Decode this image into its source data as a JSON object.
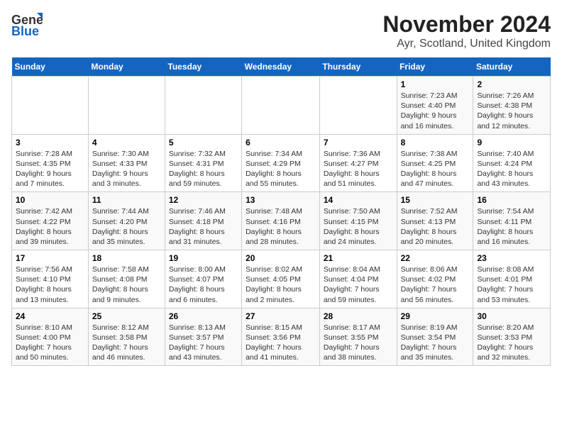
{
  "logo": {
    "line1": "General",
    "line2": "Blue"
  },
  "title": "November 2024",
  "subtitle": "Ayr, Scotland, United Kingdom",
  "headers": [
    "Sunday",
    "Monday",
    "Tuesday",
    "Wednesday",
    "Thursday",
    "Friday",
    "Saturday"
  ],
  "weeks": [
    [
      {
        "day": "",
        "info": ""
      },
      {
        "day": "",
        "info": ""
      },
      {
        "day": "",
        "info": ""
      },
      {
        "day": "",
        "info": ""
      },
      {
        "day": "",
        "info": ""
      },
      {
        "day": "1",
        "info": "Sunrise: 7:23 AM\nSunset: 4:40 PM\nDaylight: 9 hours and 16 minutes."
      },
      {
        "day": "2",
        "info": "Sunrise: 7:26 AM\nSunset: 4:38 PM\nDaylight: 9 hours and 12 minutes."
      }
    ],
    [
      {
        "day": "3",
        "info": "Sunrise: 7:28 AM\nSunset: 4:35 PM\nDaylight: 9 hours and 7 minutes."
      },
      {
        "day": "4",
        "info": "Sunrise: 7:30 AM\nSunset: 4:33 PM\nDaylight: 9 hours and 3 minutes."
      },
      {
        "day": "5",
        "info": "Sunrise: 7:32 AM\nSunset: 4:31 PM\nDaylight: 8 hours and 59 minutes."
      },
      {
        "day": "6",
        "info": "Sunrise: 7:34 AM\nSunset: 4:29 PM\nDaylight: 8 hours and 55 minutes."
      },
      {
        "day": "7",
        "info": "Sunrise: 7:36 AM\nSunset: 4:27 PM\nDaylight: 8 hours and 51 minutes."
      },
      {
        "day": "8",
        "info": "Sunrise: 7:38 AM\nSunset: 4:25 PM\nDaylight: 8 hours and 47 minutes."
      },
      {
        "day": "9",
        "info": "Sunrise: 7:40 AM\nSunset: 4:24 PM\nDaylight: 8 hours and 43 minutes."
      }
    ],
    [
      {
        "day": "10",
        "info": "Sunrise: 7:42 AM\nSunset: 4:22 PM\nDaylight: 8 hours and 39 minutes."
      },
      {
        "day": "11",
        "info": "Sunrise: 7:44 AM\nSunset: 4:20 PM\nDaylight: 8 hours and 35 minutes."
      },
      {
        "day": "12",
        "info": "Sunrise: 7:46 AM\nSunset: 4:18 PM\nDaylight: 8 hours and 31 minutes."
      },
      {
        "day": "13",
        "info": "Sunrise: 7:48 AM\nSunset: 4:16 PM\nDaylight: 8 hours and 28 minutes."
      },
      {
        "day": "14",
        "info": "Sunrise: 7:50 AM\nSunset: 4:15 PM\nDaylight: 8 hours and 24 minutes."
      },
      {
        "day": "15",
        "info": "Sunrise: 7:52 AM\nSunset: 4:13 PM\nDaylight: 8 hours and 20 minutes."
      },
      {
        "day": "16",
        "info": "Sunrise: 7:54 AM\nSunset: 4:11 PM\nDaylight: 8 hours and 16 minutes."
      }
    ],
    [
      {
        "day": "17",
        "info": "Sunrise: 7:56 AM\nSunset: 4:10 PM\nDaylight: 8 hours and 13 minutes."
      },
      {
        "day": "18",
        "info": "Sunrise: 7:58 AM\nSunset: 4:08 PM\nDaylight: 8 hours and 9 minutes."
      },
      {
        "day": "19",
        "info": "Sunrise: 8:00 AM\nSunset: 4:07 PM\nDaylight: 8 hours and 6 minutes."
      },
      {
        "day": "20",
        "info": "Sunrise: 8:02 AM\nSunset: 4:05 PM\nDaylight: 8 hours and 2 minutes."
      },
      {
        "day": "21",
        "info": "Sunrise: 8:04 AM\nSunset: 4:04 PM\nDaylight: 7 hours and 59 minutes."
      },
      {
        "day": "22",
        "info": "Sunrise: 8:06 AM\nSunset: 4:02 PM\nDaylight: 7 hours and 56 minutes."
      },
      {
        "day": "23",
        "info": "Sunrise: 8:08 AM\nSunset: 4:01 PM\nDaylight: 7 hours and 53 minutes."
      }
    ],
    [
      {
        "day": "24",
        "info": "Sunrise: 8:10 AM\nSunset: 4:00 PM\nDaylight: 7 hours and 50 minutes."
      },
      {
        "day": "25",
        "info": "Sunrise: 8:12 AM\nSunset: 3:58 PM\nDaylight: 7 hours and 46 minutes."
      },
      {
        "day": "26",
        "info": "Sunrise: 8:13 AM\nSunset: 3:57 PM\nDaylight: 7 hours and 43 minutes."
      },
      {
        "day": "27",
        "info": "Sunrise: 8:15 AM\nSunset: 3:56 PM\nDaylight: 7 hours and 41 minutes."
      },
      {
        "day": "28",
        "info": "Sunrise: 8:17 AM\nSunset: 3:55 PM\nDaylight: 7 hours and 38 minutes."
      },
      {
        "day": "29",
        "info": "Sunrise: 8:19 AM\nSunset: 3:54 PM\nDaylight: 7 hours and 35 minutes."
      },
      {
        "day": "30",
        "info": "Sunrise: 8:20 AM\nSunset: 3:53 PM\nDaylight: 7 hours and 32 minutes."
      }
    ]
  ]
}
